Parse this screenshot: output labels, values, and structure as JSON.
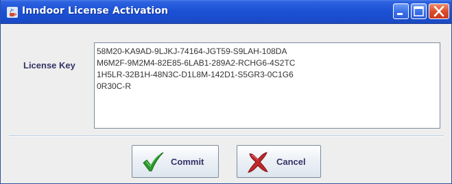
{
  "window": {
    "title": "Inndoor License Activation",
    "app_icon": "java-cup-icon",
    "controls": [
      "minimize-icon",
      "maximize-icon",
      "close-icon"
    ]
  },
  "form": {
    "license_key_label": "License Key",
    "license_key_value": "58M20-KA9AD-9LJKJ-74164-JGT59-S9LAH-108DA\nM6M2F-9M2M4-82E85-6LAB1-289A2-RCHG6-4S2TC\n1H5LR-32B1H-48N3C-D1L8M-142D1-S5GR3-0C1G6\n0R30C-R"
  },
  "buttons": {
    "commit_label": "Commit",
    "commit_icon": "checkmark-icon",
    "cancel_label": "Cancel",
    "cancel_icon": "x-mark-icon"
  },
  "colors": {
    "titlebar": "#1d52d6",
    "commit_icon": "#2a9a2a",
    "cancel_icon": "#c0282a",
    "label_text": "#333366"
  }
}
